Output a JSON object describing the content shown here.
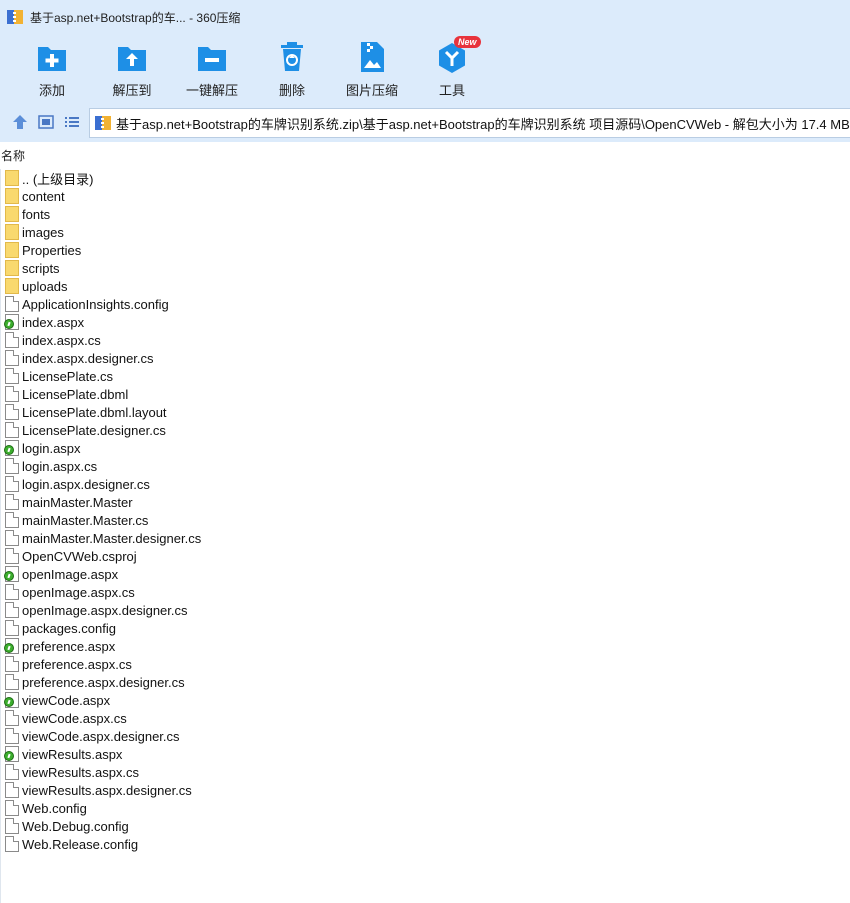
{
  "window": {
    "title": "基于asp.net+Bootstrap的车... - 360压缩"
  },
  "toolbar": {
    "buttons": [
      {
        "label": "添加",
        "icon": "add-icon"
      },
      {
        "label": "解压到",
        "icon": "extract-to-icon"
      },
      {
        "label": "一键解压",
        "icon": "one-click-extract-icon"
      },
      {
        "label": "删除",
        "icon": "delete-icon"
      },
      {
        "label": "图片压缩",
        "icon": "image-compress-icon"
      },
      {
        "label": "工具",
        "icon": "tools-icon",
        "badge": "New"
      }
    ]
  },
  "nav": {
    "path": "基于asp.net+Bootstrap的车牌识别系统.zip\\基于asp.net+Bootstrap的车牌识别系统 项目源码\\OpenCVWeb - 解包大小为 17.4 MB"
  },
  "columns": {
    "name": "名称"
  },
  "files": [
    {
      "name": ".. (上级目录)",
      "type": "folder"
    },
    {
      "name": "content",
      "type": "folder"
    },
    {
      "name": "fonts",
      "type": "folder"
    },
    {
      "name": "images",
      "type": "folder"
    },
    {
      "name": "Properties",
      "type": "folder"
    },
    {
      "name": "scripts",
      "type": "folder"
    },
    {
      "name": "uploads",
      "type": "folder"
    },
    {
      "name": "ApplicationInsights.config",
      "type": "file"
    },
    {
      "name": "index.aspx",
      "type": "aspx"
    },
    {
      "name": "index.aspx.cs",
      "type": "file"
    },
    {
      "name": "index.aspx.designer.cs",
      "type": "file"
    },
    {
      "name": "LicensePlate.cs",
      "type": "file"
    },
    {
      "name": "LicensePlate.dbml",
      "type": "file"
    },
    {
      "name": "LicensePlate.dbml.layout",
      "type": "file"
    },
    {
      "name": "LicensePlate.designer.cs",
      "type": "file"
    },
    {
      "name": "login.aspx",
      "type": "aspx"
    },
    {
      "name": "login.aspx.cs",
      "type": "file"
    },
    {
      "name": "login.aspx.designer.cs",
      "type": "file"
    },
    {
      "name": "mainMaster.Master",
      "type": "file"
    },
    {
      "name": "mainMaster.Master.cs",
      "type": "file"
    },
    {
      "name": "mainMaster.Master.designer.cs",
      "type": "file"
    },
    {
      "name": "OpenCVWeb.csproj",
      "type": "file"
    },
    {
      "name": "openImage.aspx",
      "type": "aspx"
    },
    {
      "name": "openImage.aspx.cs",
      "type": "file"
    },
    {
      "name": "openImage.aspx.designer.cs",
      "type": "file"
    },
    {
      "name": "packages.config",
      "type": "file"
    },
    {
      "name": "preference.aspx",
      "type": "aspx"
    },
    {
      "name": "preference.aspx.cs",
      "type": "file"
    },
    {
      "name": "preference.aspx.designer.cs",
      "type": "file"
    },
    {
      "name": "viewCode.aspx",
      "type": "aspx"
    },
    {
      "name": "viewCode.aspx.cs",
      "type": "file"
    },
    {
      "name": "viewCode.aspx.designer.cs",
      "type": "file"
    },
    {
      "name": "viewResults.aspx",
      "type": "aspx"
    },
    {
      "name": "viewResults.aspx.cs",
      "type": "file"
    },
    {
      "name": "viewResults.aspx.designer.cs",
      "type": "file"
    },
    {
      "name": "Web.config",
      "type": "file"
    },
    {
      "name": "Web.Debug.config",
      "type": "file"
    },
    {
      "name": "Web.Release.config",
      "type": "file"
    }
  ],
  "colors": {
    "chrome": "#dcebfb",
    "accent": "#1e8fe6",
    "badge": "#e8333c"
  }
}
